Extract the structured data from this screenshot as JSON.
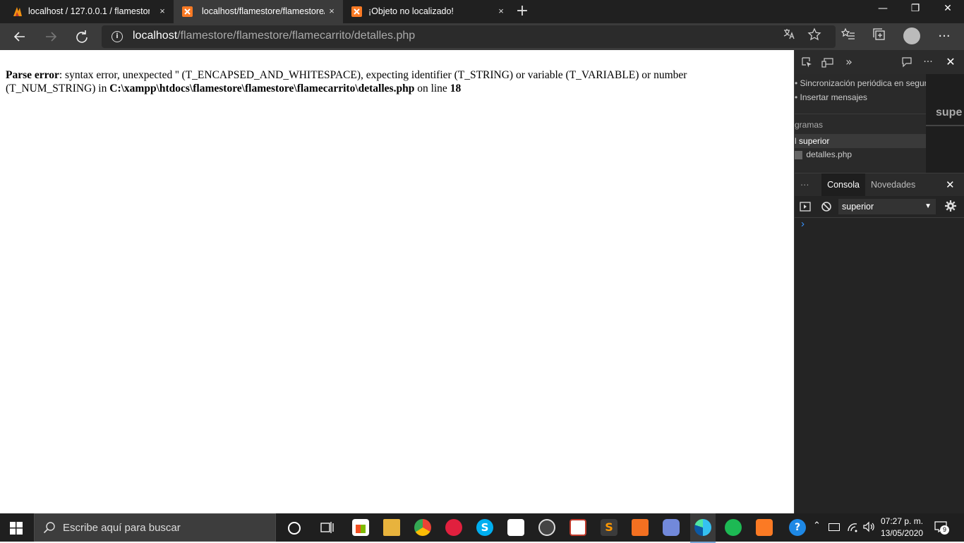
{
  "tabs": [
    {
      "title": "localhost / 127.0.0.1 / flamestore",
      "close": "×",
      "active": false
    },
    {
      "title": "localhost/flamestore/flamestore/",
      "close": "×",
      "active": true
    },
    {
      "title": "¡Objeto no localizado!",
      "close": "×",
      "active": false
    }
  ],
  "new_tab": "+",
  "window": {
    "minimize": "—",
    "restore": "❐",
    "close": "✕"
  },
  "address": {
    "host": "localhost",
    "path": "/flamestore/flamestore/flamecarrito/detalles.php"
  },
  "error": {
    "label": "Parse error",
    "message": ": syntax error, unexpected '' (T_ENCAPSED_AND_WHITESPACE), expecting identifier (T_STRING) or variable (T_VARIABLE) or number (T_NUM_STRING) in ",
    "file": "C:\\xampp\\htdocs\\flamestore\\flamestore\\flamecarrito\\detalles.php",
    "on_line": " on line ",
    "line": "18"
  },
  "devtools": {
    "tree_rows": [
      "Sincronización periódica en segur",
      "Insertar mensajes",
      "gramas",
      "superior",
      "detalles.php"
    ],
    "right_label": "supe",
    "drawer_tabs": [
      "Consola",
      "Novedades"
    ],
    "context": "superior",
    "prompt": "›",
    "dots": "···"
  },
  "taskbar": {
    "search_placeholder": "Escribe aquí para buscar",
    "time": "07:27 p. m.",
    "date": "13/05/2020",
    "notifications": "9"
  }
}
